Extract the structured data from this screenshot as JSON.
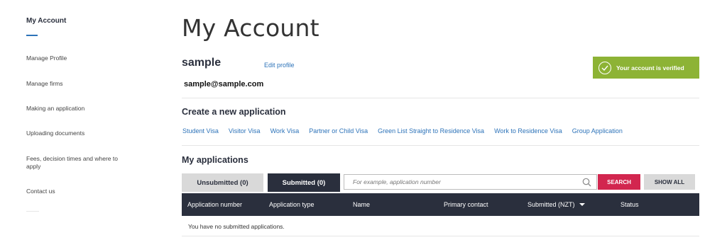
{
  "sidebar": {
    "title": "My Account",
    "items": [
      {
        "label": "Manage Profile"
      },
      {
        "label": "Manage firms"
      },
      {
        "label": "Making an application"
      },
      {
        "label": "Uploading documents"
      },
      {
        "label": "Fees, decision times and where to apply"
      },
      {
        "label": "Contact us"
      }
    ]
  },
  "header": {
    "title": "My Account"
  },
  "profile": {
    "name": "sample",
    "edit_label": "Edit profile",
    "email": "sample@sample.com",
    "verified_text": "Your account is verified",
    "verified_icon": "check-circle-icon"
  },
  "colors": {
    "accent": "#2d73b9",
    "verified": "#8db335",
    "search_button": "#d2264f",
    "dark": "#2a2f3d"
  },
  "create": {
    "title": "Create a new application",
    "links": [
      "Student Visa",
      "Visitor Visa",
      "Work Visa",
      "Partner or Child Visa",
      "Green List Straight to Residence Visa",
      "Work to Residence Visa",
      "Group Application"
    ]
  },
  "applications": {
    "title": "My applications",
    "tabs": {
      "unsubmitted": "Unsubmitted (0)",
      "submitted": "Submitted (0)"
    },
    "search": {
      "placeholder": "For example, application number",
      "button": "SEARCH",
      "show_all": "SHOW ALL",
      "icon": "search-icon"
    },
    "columns": [
      "Application number",
      "Application type",
      "Name",
      "Primary contact",
      "Submitted (NZT)",
      "Status"
    ],
    "empty_message": "You have no submitted applications."
  }
}
